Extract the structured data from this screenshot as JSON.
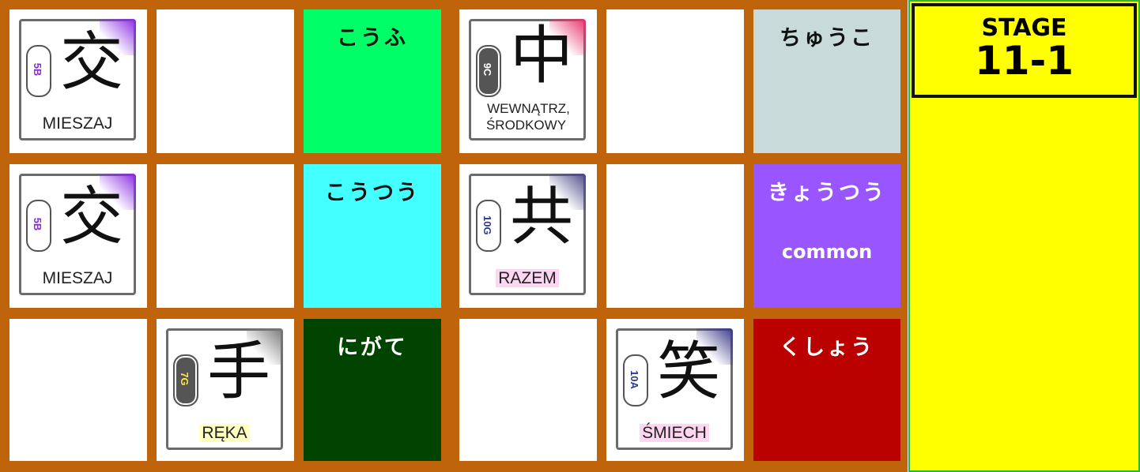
{
  "colors": {
    "board_background": "#c0640c",
    "panel_yellow": "#ffff00",
    "panel_green_border": "#2db82d"
  },
  "stage": {
    "label": "STAGE",
    "number": "11-1"
  },
  "kanji_cards": [
    {
      "kanji": "交",
      "grade": "5B",
      "meaning": "MIESZAJ",
      "cloud_color": "#ffffff",
      "grade_color": "#8a2be2",
      "corner_color": "#8a2be2",
      "label_highlight": "#ffffff"
    },
    {
      "kanji": "中",
      "grade": "9C",
      "meaning": "WEWNĄTRZ, ŚRODKOWY",
      "cloud_color": "#555555",
      "grade_color": "#ffffff",
      "corner_color": "#e8336b",
      "label_highlight": "#ffffff"
    },
    {
      "kanji": "交",
      "grade": "5B",
      "meaning": "MIESZAJ",
      "cloud_color": "#ffffff",
      "grade_color": "#8a2be2",
      "corner_color": "#8a2be2",
      "label_highlight": "#ffffff"
    },
    {
      "kanji": "共",
      "grade": "10G",
      "meaning": "RAZEM",
      "cloud_color": "#ffffff",
      "grade_color": "#2a3a8a",
      "corner_color": "#4a4a8a",
      "label_highlight": "#ffd6f2"
    },
    {
      "kanji": "手",
      "grade": "7G",
      "meaning": "RĘKA",
      "cloud_color": "#555555",
      "grade_color": "#ffeb3b",
      "corner_color": "#777777",
      "label_highlight": "#ffffc0"
    },
    {
      "kanji": "笑",
      "grade": "10A",
      "meaning": "ŚMIECH",
      "cloud_color": "#ffffff",
      "grade_color": "#2a3a8a",
      "corner_color": "#3a3a8a",
      "label_highlight": "#ffd6f2"
    }
  ],
  "kana_tiles": [
    {
      "reading": "こうふ",
      "meaning": "",
      "bg": "#00ff66",
      "text_color": "#111111"
    },
    {
      "reading": "ちゅうこ",
      "meaning": "",
      "bg": "#c8dada",
      "text_color": "#111111"
    },
    {
      "reading": "こうつう",
      "meaning": "",
      "bg": "#44ffff",
      "text_color": "#111111"
    },
    {
      "reading": "きょうつう",
      "meaning": "common",
      "bg": "#9955ff",
      "text_color": "#ffffff"
    },
    {
      "reading": "にがて",
      "meaning": "",
      "bg": "#004400",
      "text_color": "#ffffff"
    },
    {
      "reading": "くしょう",
      "meaning": "",
      "bg": "#bb0000",
      "text_color": "#ffffff"
    }
  ]
}
